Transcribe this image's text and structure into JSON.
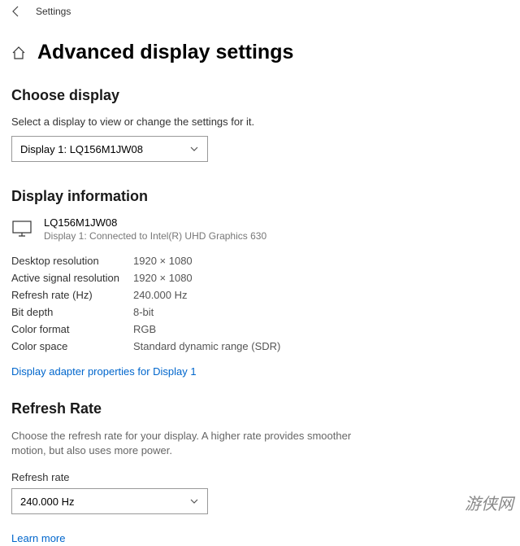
{
  "header": {
    "app_title": "Settings"
  },
  "page": {
    "title": "Advanced display settings"
  },
  "choose_display": {
    "heading": "Choose display",
    "desc": "Select a display to view or change the settings for it.",
    "selected": "Display 1: LQ156M1JW08"
  },
  "display_info": {
    "heading": "Display information",
    "monitor_name": "LQ156M1JW08",
    "monitor_sub": "Display 1: Connected to Intel(R) UHD Graphics 630",
    "rows": [
      {
        "label": "Desktop resolution",
        "value": "1920 × 1080"
      },
      {
        "label": "Active signal resolution",
        "value": "1920 × 1080"
      },
      {
        "label": "Refresh rate (Hz)",
        "value": "240.000 Hz"
      },
      {
        "label": "Bit depth",
        "value": "8-bit"
      },
      {
        "label": "Color format",
        "value": "RGB"
      },
      {
        "label": "Color space",
        "value": "Standard dynamic range (SDR)"
      }
    ],
    "adapter_link": "Display adapter properties for Display 1"
  },
  "refresh_rate": {
    "heading": "Refresh Rate",
    "desc": "Choose the refresh rate for your display. A higher rate provides smoother motion, but also uses more power.",
    "label": "Refresh rate",
    "selected": "240.000 Hz",
    "learn_more": "Learn more"
  },
  "watermark": "游侠网"
}
